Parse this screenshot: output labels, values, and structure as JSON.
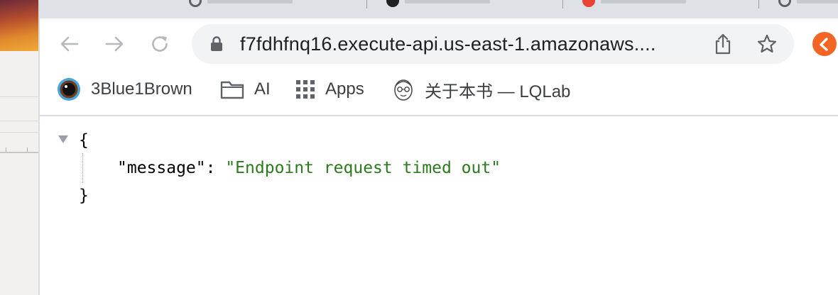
{
  "window": {
    "tabs": [
      {
        "label": ""
      },
      {
        "label": ""
      },
      {
        "label": ""
      },
      {
        "label": ""
      }
    ]
  },
  "toolbar": {
    "back_icon": "arrow-left-icon",
    "forward_icon": "arrow-right-icon",
    "reload_icon": "reload-icon",
    "address": "f7fdhfnq16.execute-api.us-east-1.amazonaws....",
    "share_icon": "share-icon",
    "bookmark_icon": "star-icon",
    "extension_color": "#f26522"
  },
  "bookmarks": [
    {
      "label": "3Blue1Brown",
      "icon": "3blue1brown-icon"
    },
    {
      "label": "AI",
      "icon": "folder-icon"
    },
    {
      "label": "Apps",
      "icon": "apps-grid-icon"
    },
    {
      "label": "关于本书 — LQLab",
      "icon": "lqlab-avatar-icon"
    }
  ],
  "json_view": {
    "open_brace": "{",
    "close_brace": "}",
    "key": "\"message\"",
    "colon": ": ",
    "value": "\"Endpoint request timed out\"",
    "value_color": "#2b7a1d"
  }
}
